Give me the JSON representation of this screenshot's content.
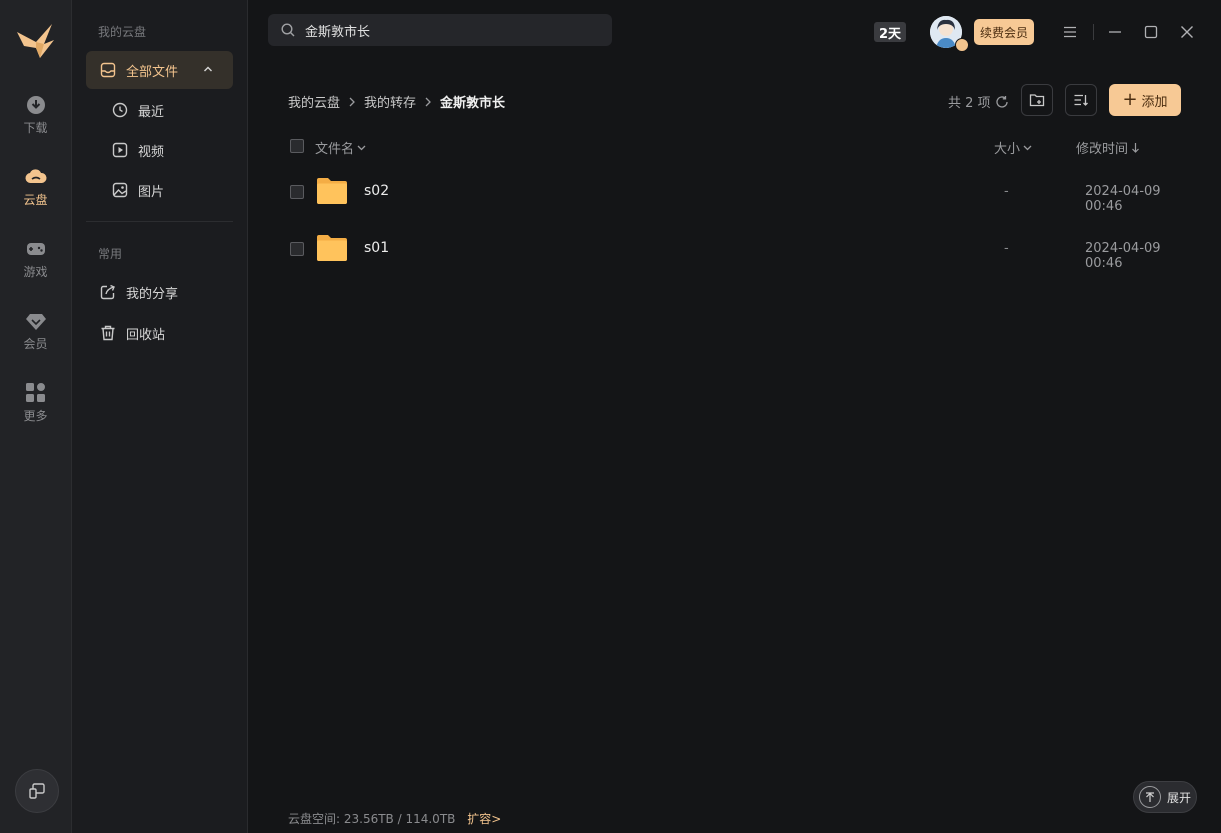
{
  "rail": {
    "items": [
      {
        "label": "下载",
        "icon": "download-icon"
      },
      {
        "label": "云盘",
        "icon": "cloud-icon"
      },
      {
        "label": "游戏",
        "icon": "gamepad-icon"
      },
      {
        "label": "会员",
        "icon": "diamond-icon"
      },
      {
        "label": "更多",
        "icon": "grid-icon"
      }
    ],
    "active": "云盘"
  },
  "sidebar": {
    "section_title": "我的云盘",
    "all_files": "全部文件",
    "sub_items": [
      {
        "label": "最近",
        "icon": "clock-icon"
      },
      {
        "label": "视频",
        "icon": "video-icon"
      },
      {
        "label": "图片",
        "icon": "image-icon"
      }
    ],
    "common_title": "常用",
    "common_items": [
      {
        "label": "我的分享",
        "icon": "share-icon"
      },
      {
        "label": "回收站",
        "icon": "trash-icon"
      }
    ]
  },
  "search": {
    "value": "金斯敦市长"
  },
  "topbar": {
    "days_badge": "2天",
    "vip_button": "续费会员"
  },
  "breadcrumb": [
    "我的云盘",
    "我的转存",
    "金斯敦市长"
  ],
  "toolbar": {
    "count_text": "共 2 项",
    "add_label": "添加"
  },
  "table": {
    "headers": {
      "name": "文件名",
      "size": "大小",
      "modified": "修改时间"
    },
    "rows": [
      {
        "name": "s02",
        "size": "-",
        "modified": "2024-04-09 00:46"
      },
      {
        "name": "s01",
        "size": "-",
        "modified": "2024-04-09 00:46"
      }
    ]
  },
  "footer": {
    "storage_label": "云盘空间:",
    "storage_value": "23.56TB / 114.0TB",
    "expand_link": "扩容>",
    "unfold_label": "展开"
  },
  "colors": {
    "accent": "#f3c48e",
    "button_bg": "#f7c995",
    "background": "#141517",
    "folder": "#ffc35c"
  }
}
